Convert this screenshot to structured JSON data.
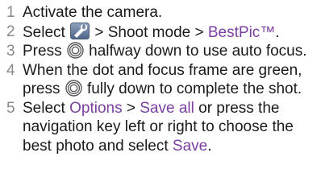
{
  "steps": [
    {
      "num": "1",
      "t1": "Activate the camera."
    },
    {
      "num": "2",
      "t1": "Select",
      "t2": " > Shoot mode > ",
      "link1": "BestPic™",
      "t3": "."
    },
    {
      "num": "3",
      "t1": "Press",
      "t2": " halfway down to use auto focus."
    },
    {
      "num": "4",
      "t1": "When the dot and focus frame are green, press",
      "t2": " fully down to complete the shot."
    },
    {
      "num": "5",
      "t1": "Select ",
      "link1": "Options",
      "t2": " > ",
      "link2": "Save all",
      "t3": " or press the navigation key left or right to choose the best photo and select ",
      "link3": "Save",
      "t4": "."
    }
  ],
  "icons": {
    "camera_settings": "camera-settings-icon",
    "shutter": "shutter-key-icon"
  },
  "colors": {
    "text": "#1a1a1a",
    "step_number": "#8a8a8a",
    "link": "#7b3fa0"
  }
}
